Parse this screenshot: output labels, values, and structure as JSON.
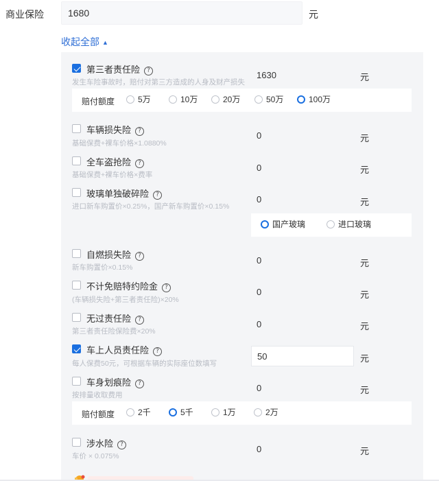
{
  "header": {
    "label": "商业保险",
    "value": "1680",
    "unit": "元"
  },
  "collapse_label": "收起全部",
  "collapse_caret": "▲",
  "help_glyph": "?",
  "items": [
    {
      "name": "第三者责任险",
      "checked": true,
      "desc": "发生车险事故时，赔付对第三方造成的人身及财产损失",
      "value": "1630",
      "unit": "元"
    },
    {
      "name": "车辆损失险",
      "checked": false,
      "desc": "基础保费+裸车价格×1.0880%",
      "value": "0",
      "unit": "元"
    },
    {
      "name": "全车盗抢险",
      "checked": false,
      "desc": "基础保费+裸车价格×费率",
      "value": "0",
      "unit": "元"
    },
    {
      "name": "玻璃单独破碎险",
      "checked": false,
      "desc": "进口新车购置价×0.25%，国产新车购置价×0.15%",
      "value": "0",
      "unit": "元"
    },
    {
      "name": "自燃损失险",
      "checked": false,
      "desc": "新车购置价×0.15%",
      "value": "0",
      "unit": "元"
    },
    {
      "name": "不计免赔特约险金",
      "checked": false,
      "desc": "(车辆损失险+第三者责任险)×20%",
      "value": "0",
      "unit": "元"
    },
    {
      "name": "无过责任险",
      "checked": false,
      "desc": "第三者责任险保险费×20%",
      "value": "0",
      "unit": "元"
    },
    {
      "name": "车上人员责任险",
      "checked": true,
      "desc": "每人保费50元，可根据车辆的实际座位数填写",
      "value": "50",
      "unit": "元"
    },
    {
      "name": "车身划痕险",
      "checked": false,
      "desc": "按排量收取费用",
      "value": "0",
      "unit": "元"
    },
    {
      "name": "涉水险",
      "checked": false,
      "desc": "车价 × 0.075%",
      "value": "0",
      "unit": "元"
    }
  ],
  "third_party_coverage": {
    "label": "赔付额度",
    "options": [
      "5万",
      "10万",
      "20万",
      "50万",
      "100万"
    ],
    "selected": "100万"
  },
  "glass_type": {
    "options": [
      "国产玻璃",
      "进口玻璃"
    ],
    "selected": "国产玻璃"
  },
  "scratch_coverage": {
    "label": "赔付额度",
    "options": [
      "2千",
      "5千",
      "1万",
      "2万"
    ],
    "selected": "5千"
  },
  "colors": {
    "accent": "#1a6fe0",
    "link": "#2f6fd6",
    "panel_bg": "#f4f5f7",
    "desc_text": "#b8bcc4"
  }
}
